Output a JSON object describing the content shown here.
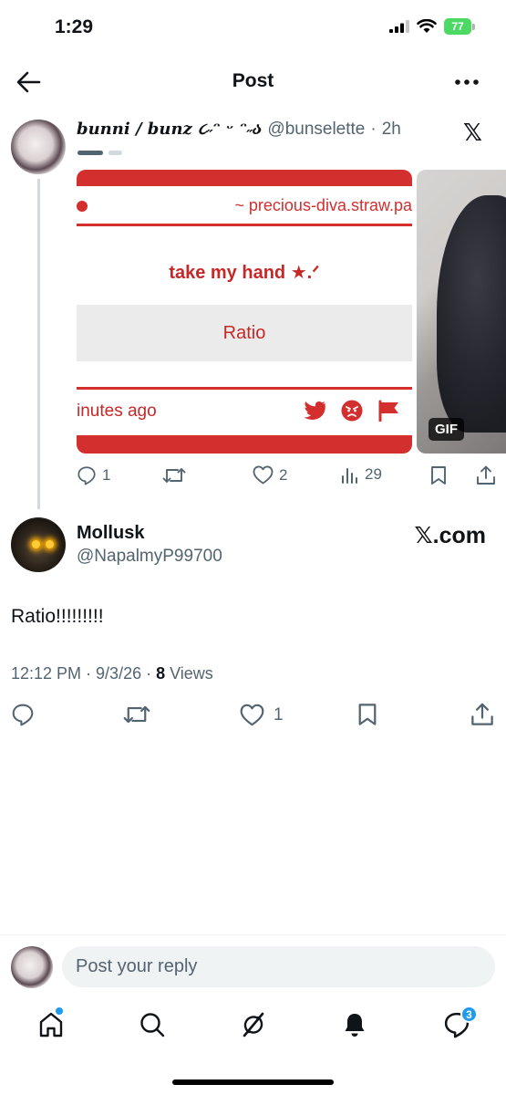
{
  "status_bar": {
    "time": "1:29",
    "battery": "77"
  },
  "header": {
    "title": "Post"
  },
  "quoted_post": {
    "display_name": "bunni / bunz ૮˶ᵔ ᵕ ᵔ˶ა",
    "handle": "@bunselette",
    "separator": "·",
    "time": "2h",
    "platform_logo": "𝕏",
    "card": {
      "url": "~ precious-diva.straw.pa",
      "title": "take my hand ★.ᐟ",
      "button_label": "Ratio",
      "footer_text": "inutes ago"
    },
    "gif_label": "GIF",
    "actions": {
      "replies": "1",
      "likes": "2",
      "views": "29"
    }
  },
  "main_post": {
    "display_name": "Mollusk",
    "handle": "@NapalmyP99700",
    "source_label": "𝕏.com",
    "text": "Ratio!!!!!!!!!",
    "timestamp": "12:12 PM · 9/3/26 · ",
    "views_count": "8",
    "views_label": " Views",
    "actions": {
      "likes": "1"
    }
  },
  "reply_bar": {
    "placeholder": "Post your reply"
  },
  "tab_bar": {
    "messages_badge": "3"
  },
  "colors": {
    "accent": "#1d9bf0",
    "card_red": "#d32f2f",
    "muted": "#536471"
  }
}
